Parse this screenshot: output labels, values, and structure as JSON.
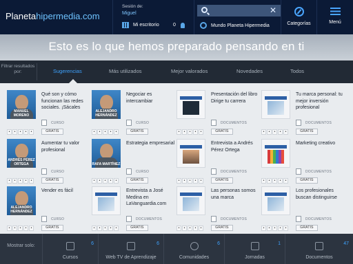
{
  "header": {
    "logo_part1": "Planeta",
    "logo_part2": "hipermedia.com",
    "session_label": "Sesión de:",
    "session_user": "Miguel",
    "desk_label": "Mi escritorio",
    "notifications": "0",
    "search_placeholder": "",
    "mundo_label": "Mundo Planeta Hipermedia",
    "categories_label": "Categorías",
    "menu_label": "Menú"
  },
  "hero": {
    "text": "Esto es lo que hemos preparado pensando en ti"
  },
  "filter": {
    "label": "Filtrar resultados por:",
    "tabs": [
      "Sugerencias",
      "Más utilizados",
      "Mejor valorados",
      "Novedades",
      "Todos"
    ],
    "active": "Sugerencias"
  },
  "cards": [
    {
      "title": "Qué son y cómo funcionan las redes sociales. ¡Sácales",
      "type": "CURSO",
      "price": "GRATIS",
      "person": "MANUEL MORENO",
      "thumb_icon": "person-portrait",
      "rating": 0
    },
    {
      "title": "Negociar es intercambiar",
      "type": "CURSO",
      "price": "GRATIS",
      "person": "ALEJANDRO HERNÁNDEZ",
      "thumb_icon": "person-portrait",
      "rating": 0
    },
    {
      "title": "Presentación del libro Dirige tu carrera",
      "type": "DOCUMENTOS",
      "price": "GRATIS",
      "person": "",
      "thumb_icon": "document-dark",
      "rating": 0
    },
    {
      "title": "Tu marca personal: tu mejor inversión profesional",
      "type": "DOCUMENTOS",
      "price": "GRATIS",
      "person": "",
      "thumb_icon": "document-cover",
      "rating": 0
    },
    {
      "title": "Aumentar tu valor profesional",
      "type": "CURSO",
      "price": "GRATIS",
      "person": "ANDRÉS PÉREZ ORTEGA",
      "thumb_icon": "person-portrait",
      "rating": 0
    },
    {
      "title": "Estrategia empresarial",
      "type": "CURSO",
      "price": "GRATIS",
      "person": "RAFA MARTÍNEZ",
      "thumb_icon": "person-portrait",
      "rating": 0
    },
    {
      "title": "Entrevista a Andrés Pérez Ortega",
      "type": "DOCUMENTOS",
      "price": "GRATIS",
      "person": "",
      "thumb_icon": "document-photo",
      "rating": 0
    },
    {
      "title": "Marketing creativo",
      "type": "DOCUMENTOS",
      "price": "GRATIS",
      "person": "",
      "thumb_icon": "document-pencils",
      "rating": 0
    },
    {
      "title": "Vender es fácil",
      "type": "CURSO",
      "price": "GRATIS",
      "person": "ALEJANDRO HERNÁNDEZ",
      "thumb_icon": "person-portrait",
      "rating": 0
    },
    {
      "title": "Entrevista a José Medina en LaVanguardia.com",
      "type": "DOCUMENTOS",
      "price": "GRATIS",
      "person": "",
      "thumb_icon": "document-cover",
      "rating": 0
    },
    {
      "title": "Las personas somos una marca",
      "type": "DOCUMENTOS",
      "price": "GRATIS",
      "person": "",
      "thumb_icon": "document-cover",
      "rating": 0
    },
    {
      "title": "Los profesionales buscan distinguirse",
      "type": "DOCUMENTOS",
      "price": "GRATIS",
      "person": "",
      "thumb_icon": "document-cover",
      "rating": 0
    }
  ],
  "bottom": {
    "label": "Mostrar solo:",
    "sections": [
      {
        "label": "Cursos",
        "count": "6",
        "icon": "book-icon"
      },
      {
        "label": "Web TV de Aprendizaje",
        "count": "6",
        "icon": "video-camera-icon"
      },
      {
        "label": "Comunidades",
        "count": "6",
        "icon": "people-icon"
      },
      {
        "label": "Jornadas",
        "count": "1",
        "icon": "bookmark-icon"
      },
      {
        "label": "Documentos",
        "count": "47",
        "icon": "document-icon"
      }
    ]
  },
  "colors": {
    "header_bg": "#0b1a36",
    "accent": "#3ea3ff",
    "filter_bg": "#222a35",
    "bottom_bg": "#2c3440",
    "content_bg": "#e9ecef"
  }
}
